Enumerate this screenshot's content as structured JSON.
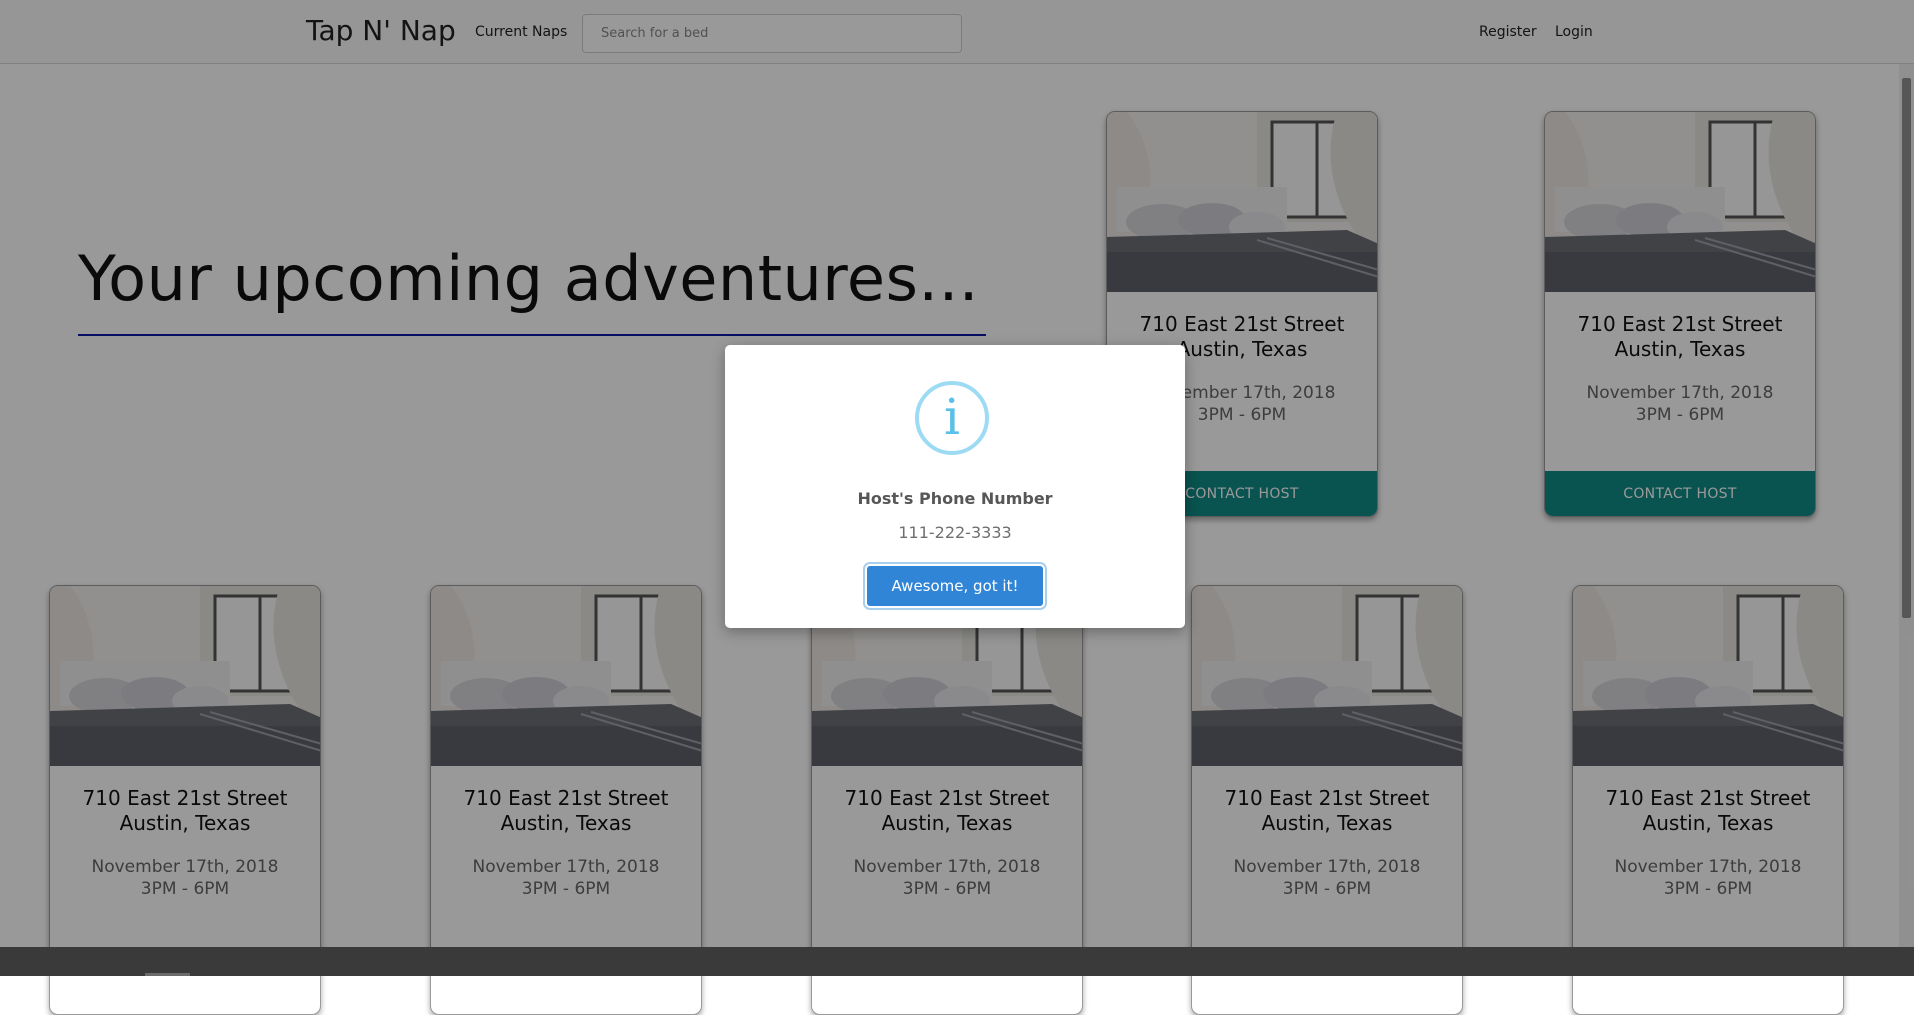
{
  "nav": {
    "brand": "Tap N' Nap",
    "current_naps": "Current Naps",
    "search_placeholder": "Search for a bed",
    "register": "Register",
    "login": "Login"
  },
  "hero": {
    "title": "Your upcoming adventures..."
  },
  "cards": [
    {
      "address_line1": "710 East 21st Street",
      "address_line2": "Austin, Texas",
      "date": "November 17th, 2018",
      "time": "3PM - 6PM",
      "button": "CONTACT HOST"
    },
    {
      "address_line1": "710 East 21st Street",
      "address_line2": "Austin, Texas",
      "date": "November 17th, 2018",
      "time": "3PM - 6PM",
      "button": "CONTACT HOST"
    },
    {
      "address_line1": "710 East 21st Street",
      "address_line2": "Austin, Texas",
      "date": "November 17th, 2018",
      "time": "3PM - 6PM"
    },
    {
      "address_line1": "710 East 21st Street",
      "address_line2": "Austin, Texas",
      "date": "November 17th, 2018",
      "time": "3PM - 6PM"
    },
    {
      "address_line1": "710 East 21st Street",
      "address_line2": "Austin, Texas",
      "date": "November 17th, 2018",
      "time": "3PM - 6PM"
    },
    {
      "address_line1": "710 East 21st Street",
      "address_line2": "Austin, Texas",
      "date": "November 17th, 2018",
      "time": "3PM - 6PM"
    },
    {
      "address_line1": "710 East 21st Street",
      "address_line2": "Austin, Texas",
      "date": "November 17th, 2018",
      "time": "3PM - 6PM"
    }
  ],
  "modal": {
    "icon": "info-icon",
    "icon_glyph": "i",
    "title": "Host's Phone Number",
    "text": "111-222-3333",
    "confirm": "Awesome, got it!"
  },
  "colors": {
    "accent_teal": "#0f8a86",
    "hero_underline": "#0a1aa8",
    "confirm_button": "#3085d6",
    "info_icon": "#5bc0e8"
  }
}
